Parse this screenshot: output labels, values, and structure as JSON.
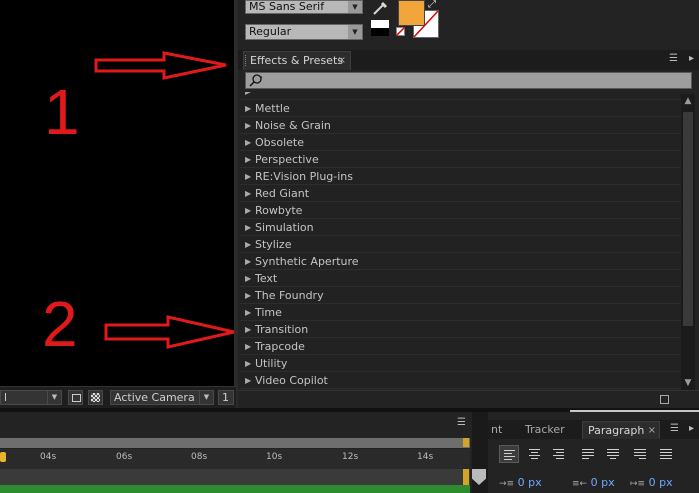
{
  "character_panel": {
    "font_family": "MS Sans Serif",
    "font_style": "Regular",
    "fill_color": "#f2a53a"
  },
  "composition_bar": {
    "view_menu_value": "l",
    "camera_menu_value": "Active Camera",
    "views_value": "1"
  },
  "effects_panel": {
    "tab_label": "Effects & Presets",
    "close_glyph": "×",
    "search_value": "",
    "items": [
      {
        "label": "Mettle"
      },
      {
        "label": "Noise & Grain"
      },
      {
        "label": "Obsolete"
      },
      {
        "label": "Perspective"
      },
      {
        "label": "RE:Vision Plug-ins"
      },
      {
        "label": "Red Giant"
      },
      {
        "label": "Rowbyte"
      },
      {
        "label": "Simulation"
      },
      {
        "label": "Stylize"
      },
      {
        "label": "Synthetic Aperture"
      },
      {
        "label": "Text"
      },
      {
        "label": "The Foundry"
      },
      {
        "label": "Time"
      },
      {
        "label": "Transition"
      },
      {
        "label": "Trapcode"
      },
      {
        "label": "Utility"
      },
      {
        "label": "Video Copilot"
      }
    ]
  },
  "annotations": {
    "label_1": "1",
    "label_2": "2",
    "arrow_color": "#e0191b"
  },
  "timeline": {
    "ticks": [
      "04s",
      "06s",
      "08s",
      "10s",
      "12s",
      "14s"
    ]
  },
  "bottom_right_panel": {
    "tabs": [
      {
        "label": "nt"
      },
      {
        "label": "Tracker"
      },
      {
        "label": "Paragraph"
      }
    ],
    "close_glyph": "×",
    "indent_values": [
      "0 px",
      "0 px",
      "0 px"
    ]
  }
}
